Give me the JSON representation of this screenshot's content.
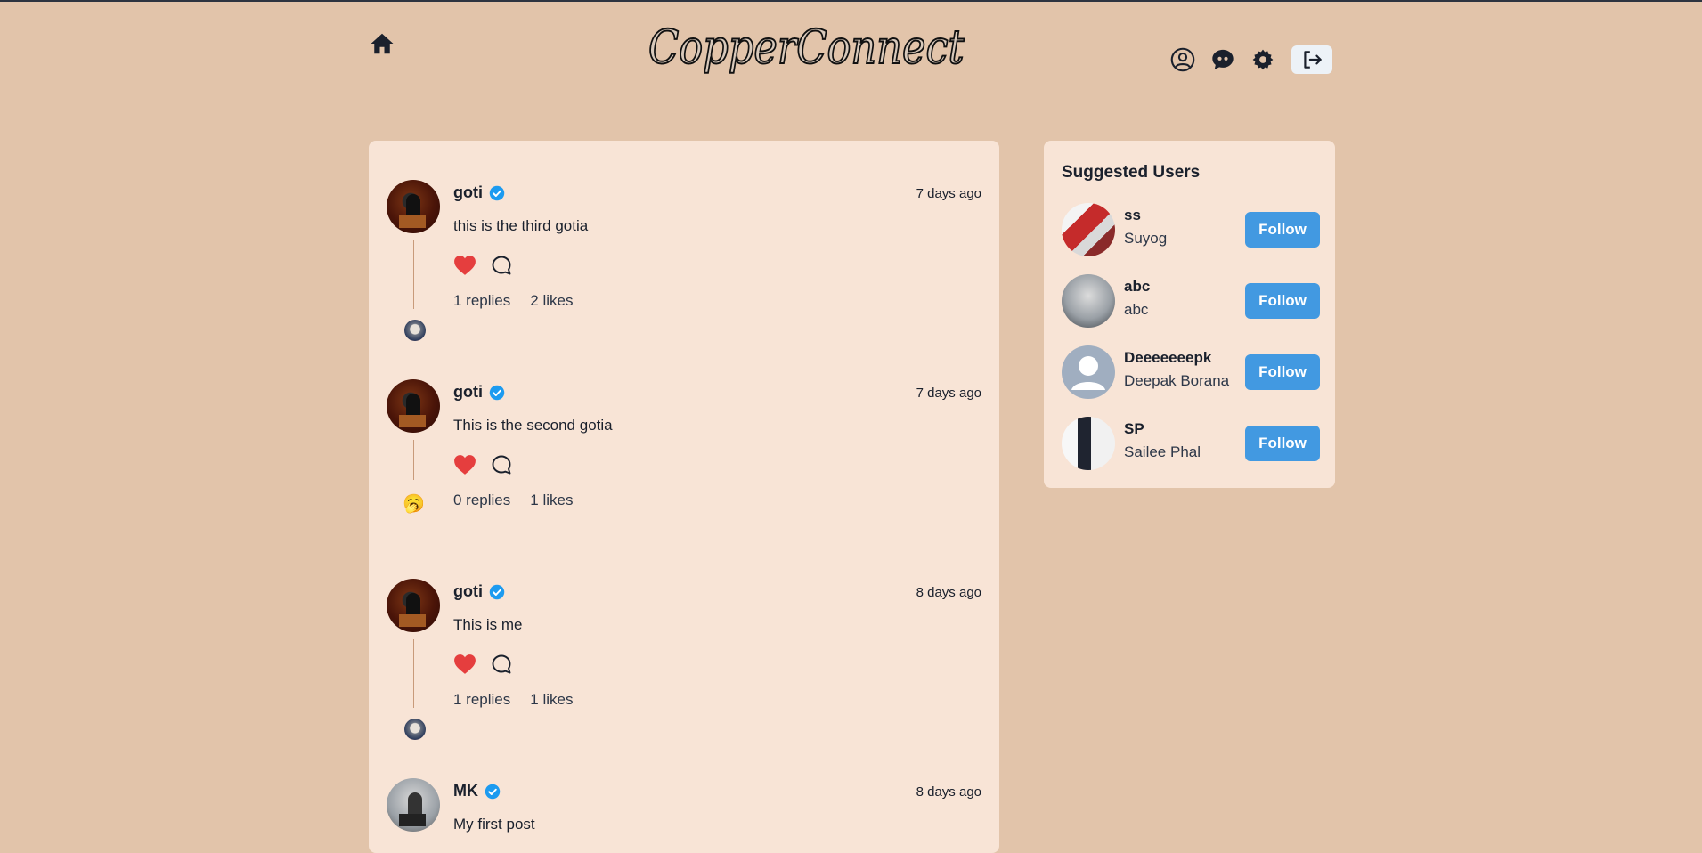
{
  "header": {
    "logo_text": "CopperConnect",
    "icons": [
      "home-icon",
      "profile-icon",
      "chat-icon",
      "settings-icon",
      "logout-icon"
    ]
  },
  "posts": [
    {
      "username": "goti",
      "verified": true,
      "time": "7 days ago",
      "text": "this is the third gotia",
      "replies": "1 replies",
      "likes": "2 likes"
    },
    {
      "username": "goti",
      "verified": true,
      "time": "7 days ago",
      "text": "This is the second gotia",
      "replies": "0 replies",
      "likes": "1 likes"
    },
    {
      "username": "goti",
      "verified": true,
      "time": "8 days ago",
      "text": "This is me",
      "replies": "1 replies",
      "likes": "1 likes"
    },
    {
      "username": "MK",
      "verified": true,
      "time": "8 days ago",
      "text": "My first post"
    }
  ],
  "suggested": {
    "title": "Suggested Users",
    "users": [
      {
        "handle": "ss",
        "name": "Suyog",
        "button": "Follow"
      },
      {
        "handle": "abc",
        "name": "abc",
        "button": "Follow"
      },
      {
        "handle": "Deeeeeeepk",
        "name": "Deepak Borana",
        "button": "Follow"
      },
      {
        "handle": "SP",
        "name": "Sailee Phal",
        "button": "Follow"
      }
    ]
  },
  "colors": {
    "page_bg": "#e2c4aa",
    "card_bg": "#f8e4d6",
    "accent": "#4299e1",
    "like": "#e53e3e"
  }
}
